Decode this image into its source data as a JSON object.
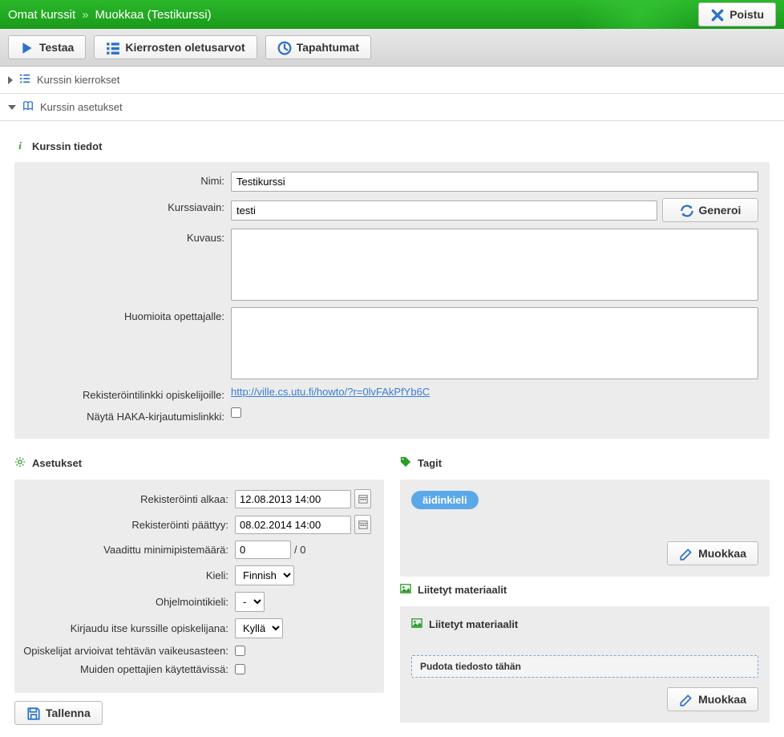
{
  "header": {
    "breadcrumb1": "Omat kurssit",
    "breadcrumb_sep": "»",
    "breadcrumb2": "Muokkaa (Testikurssi)",
    "exit": "Poistu"
  },
  "toolbar": {
    "testaa": "Testaa",
    "kierrosten": "Kierrosten oletusarvot",
    "tapahtumat": "Tapahtumat"
  },
  "panels": {
    "rounds": "Kurssin kierrokset",
    "settings": "Kurssin asetukset"
  },
  "course_info": {
    "header": "Kurssin tiedot",
    "name_label": "Nimi:",
    "name_value": "Testikurssi",
    "key_label": "Kurssiavain:",
    "key_value": "testi",
    "generate": "Generoi",
    "desc_label": "Kuvaus:",
    "desc_value": "",
    "notes_label": "Huomioita opettajalle:",
    "notes_value": "",
    "reglink_label": "Rekisteröintilinkki opiskelijoille:",
    "reglink_value": "http://ville.cs.utu.fi/howto/?r=0lvFAkPfYb6C",
    "haka_label": "Näytä HAKA-kirjautumislinkki:"
  },
  "settings": {
    "header": "Asetukset",
    "reg_start_label": "Rekisteröinti alkaa:",
    "reg_start_value": "12.08.2013 14:00",
    "reg_end_label": "Rekisteröinti päättyy:",
    "reg_end_value": "08.02.2014 14:00",
    "min_points_label": "Vaadittu minimipistemäärä:",
    "min_points_value": "0",
    "min_points_total": "/ 0",
    "lang_label": "Kieli:",
    "lang_value": "Finnish",
    "proglang_label": "Ohjelmointikieli:",
    "proglang_value": "-",
    "selfenroll_label": "Kirjaudu itse kurssille opiskelijana:",
    "selfenroll_value": "Kyllä",
    "difficulty_label": "Opiskelijat arvioivat tehtävän vaikeusasteen:",
    "available_label": "Muiden opettajien käytettävissä:",
    "save": "Tallenna"
  },
  "tags": {
    "header": "Tagit",
    "tag1": "äidinkieli",
    "edit": "Muokkaa"
  },
  "materials": {
    "header": "Liitetyt materiaalit",
    "inner_header": "Liitetyt materiaalit",
    "dropzone": "Pudota tiedosto tähän",
    "edit": "Muokkaa"
  }
}
